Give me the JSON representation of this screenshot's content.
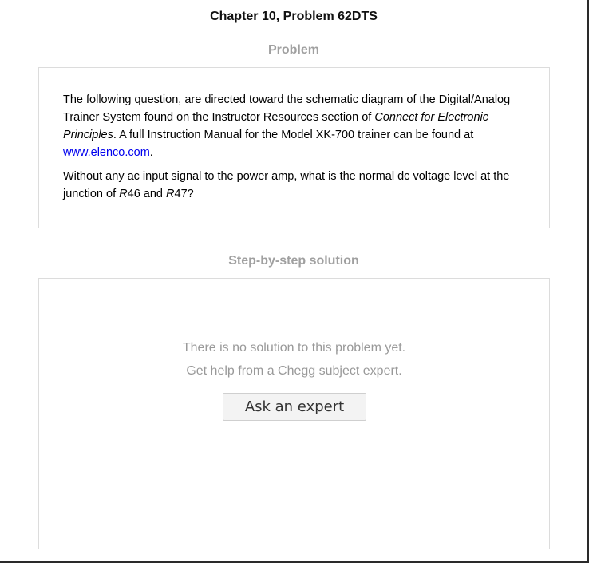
{
  "page": {
    "title": "Chapter 10, Problem 62DTS"
  },
  "problem": {
    "heading": "Problem",
    "paragraph1": {
      "intro": "The following question, are directed toward the schematic diagram of the Digital/Analog Trainer System found on the Instructor Resources section of ",
      "book_title": "Connect for Electronic Principles",
      "middle": ". A full Instruction Manual for the Model XK-700 trainer can be found at ",
      "link_text": "www.elenco.com",
      "end": "."
    },
    "paragraph2": {
      "text_a": "Without any ac input signal to the power amp, what is the normal dc voltage level at the junction of ",
      "r46": "R",
      "r46_num": "46",
      "and": " and ",
      "r47": "R",
      "r47_num": "47",
      "end": "?"
    }
  },
  "solution": {
    "heading": "Step-by-step solution",
    "no_solution_text": "There is no solution to this problem yet.",
    "help_text": "Get help from a Chegg subject expert.",
    "ask_button_label": "Ask an expert"
  },
  "colors": {
    "heading_gray": "#a0a0a0",
    "link_blue": "#0000ee",
    "box_border": "#dcdcdc"
  }
}
